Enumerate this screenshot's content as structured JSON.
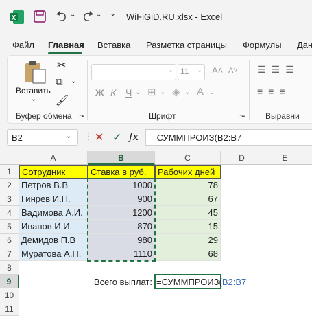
{
  "titlebar": {
    "title": "WiFiGiD.RU.xlsx  -  Excel"
  },
  "tabs": [
    {
      "label": "Файл"
    },
    {
      "label": "Главная"
    },
    {
      "label": "Вставка"
    },
    {
      "label": "Разметка страницы"
    },
    {
      "label": "Формулы"
    },
    {
      "label": "Дан"
    }
  ],
  "ribbon": {
    "paste_label": "Вставить",
    "clipboard_label": "Буфер обмена",
    "font_label": "Шрифт",
    "font_size": "11",
    "alignment_label": "Выравни",
    "bold": "Ж",
    "italic": "К",
    "underline": "Ч"
  },
  "formula_bar": {
    "name_box": "B2",
    "fx": "fx",
    "formula": "=СУММПРОИЗ(B2:B7"
  },
  "columns": [
    "A",
    "B",
    "C",
    "D",
    "E"
  ],
  "rows": [
    "1",
    "2",
    "3",
    "4",
    "5",
    "6",
    "7",
    "8",
    "9",
    "10",
    "11"
  ],
  "sheet": {
    "headers": [
      "Сотрудник",
      "Ставка в руб.",
      "Рабочих дней"
    ],
    "data": [
      [
        "Петров В.В",
        "1000",
        "78"
      ],
      [
        "Гинрев И.П.",
        "900",
        "67"
      ],
      [
        "Вадимова А.И.",
        "1200",
        "45"
      ],
      [
        "Иванов И.И.",
        "870",
        "15"
      ],
      [
        "Демидов П.В",
        "980",
        "29"
      ],
      [
        "Муратова А.П.",
        "1110",
        "68"
      ]
    ],
    "total_label": "Всего выплат:",
    "total_formula_prefix": "=СУММПРОИЗ(",
    "total_formula_ref": "B2:B7"
  },
  "colors": {
    "accent": "#217346",
    "header_fill": "#ffff00",
    "name_fill": "#ddebf7",
    "days_fill": "#e2efda"
  }
}
